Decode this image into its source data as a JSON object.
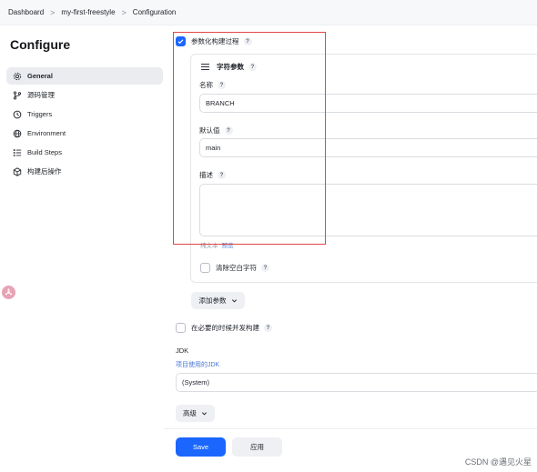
{
  "breadcrumb": {
    "items": [
      "Dashboard",
      "my-first-freestyle",
      "Configuration"
    ],
    "separator": ">"
  },
  "page_title": "Configure",
  "sidebar": {
    "items": [
      {
        "label": "General",
        "icon": "gear-icon",
        "active": true
      },
      {
        "label": "源码管理",
        "icon": "source-branch-icon",
        "active": false
      },
      {
        "label": "Triggers",
        "icon": "clock-icon",
        "active": false
      },
      {
        "label": "Environment",
        "icon": "globe-icon",
        "active": false
      },
      {
        "label": "Build Steps",
        "icon": "list-steps-icon",
        "active": false
      },
      {
        "label": "构建后操作",
        "icon": "cube-icon",
        "active": false
      }
    ]
  },
  "main": {
    "parameterized": {
      "label": "参数化构建过程",
      "help": "?",
      "checked": true
    },
    "string_param": {
      "title": "字符参数",
      "help": "?",
      "name_label": "名称",
      "name_value": "BRANCH",
      "default_label": "默认值",
      "default_value": "main",
      "desc_label": "描述",
      "desc_value": "",
      "plain_text": "纯文本",
      "preview": "预览",
      "trim_label": "清除空白字符",
      "trim_checked": false
    },
    "add_param_label": "添加参数",
    "concurrent": {
      "label": "在必要的时候并发构建",
      "help": "?",
      "checked": false
    },
    "jdk": {
      "label": "JDK",
      "sub_label": "项目使用的JDK",
      "value": "(System)"
    },
    "advanced_label": "高级",
    "save_label": "Save",
    "apply_label": "应用"
  },
  "watermark": "CSDN @遇见火星",
  "colors": {
    "accent": "#1a66ff",
    "highlight_border": "#e04848",
    "link": "#4a78d8"
  }
}
